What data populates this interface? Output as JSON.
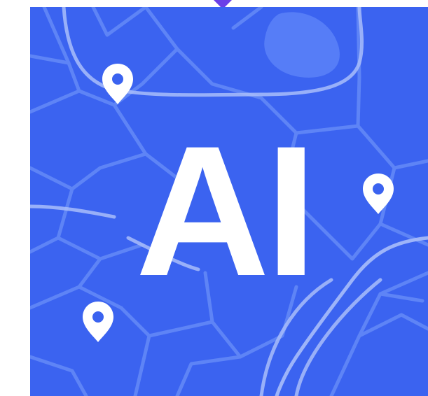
{
  "logo": {
    "text": "AI",
    "icon": "map-ai-logo",
    "colors": {
      "background": "#3B63F0",
      "road_minor": "#5E84F6",
      "road_major": "#A9BDFA",
      "blob": "#567DF7",
      "text": "#FFFFFF",
      "pin": "#FFFFFF",
      "notch": "#6A3FE8"
    }
  },
  "pins": [
    {
      "icon": "map-pin-icon"
    },
    {
      "icon": "map-pin-icon"
    },
    {
      "icon": "map-pin-icon"
    }
  ]
}
